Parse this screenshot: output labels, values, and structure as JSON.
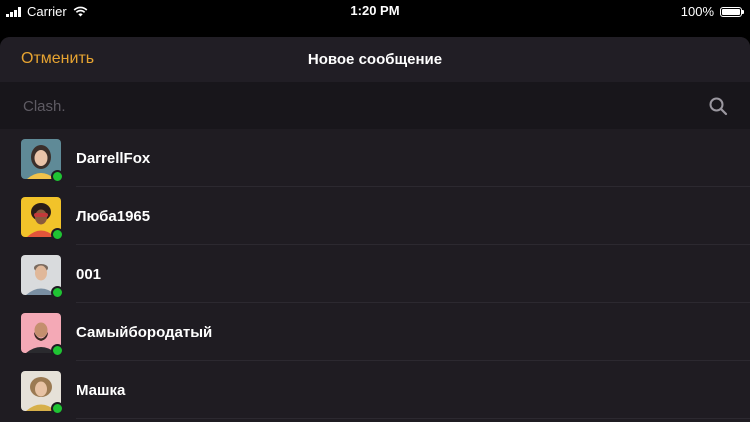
{
  "status_bar": {
    "carrier": "Carrier",
    "time": "1:20 PM",
    "battery": "100%"
  },
  "header": {
    "cancel_label": "Отменить",
    "title": "Новое сообщение"
  },
  "search": {
    "placeholder": "Clash."
  },
  "contacts": [
    {
      "name": "DarrellFox",
      "online": true,
      "avatar_bg": "#5f8a97"
    },
    {
      "name": "Люба1965",
      "online": true,
      "avatar_bg": "#f2c32a"
    },
    {
      "name": "001",
      "online": true,
      "avatar_bg": "#d9dbdd"
    },
    {
      "name": "Самыйбородатый",
      "online": true,
      "avatar_bg": "#f4a9b6"
    },
    {
      "name": "Машка",
      "online": true,
      "avatar_bg": "#e6e1d8"
    }
  ],
  "colors": {
    "accent": "#e7a431",
    "online": "#1fc433",
    "sheet_bg": "#1f1c22"
  }
}
